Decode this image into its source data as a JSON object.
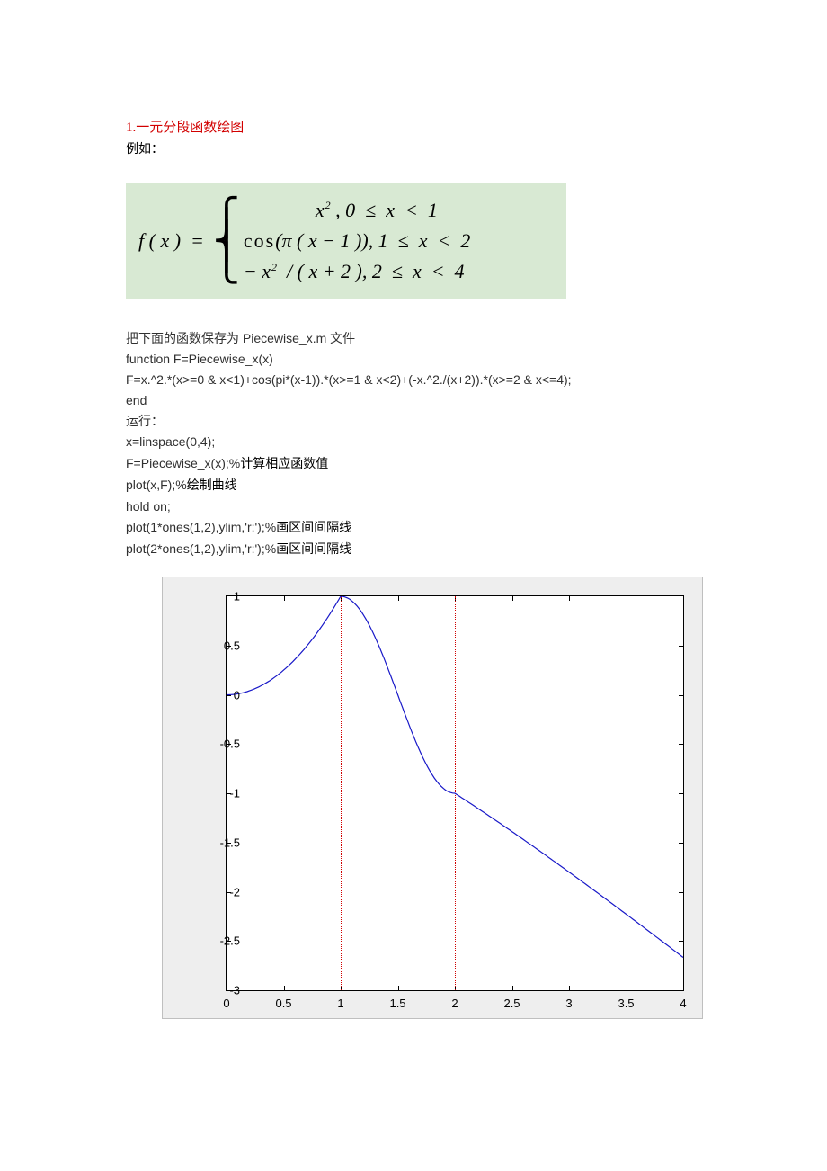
{
  "heading": "1.一元分段函数绘图",
  "example_label": "例如：",
  "equation": {
    "lhs": "f ( x )  =",
    "lines": [
      "x², 0 ≤ x < 1",
      "cos(π(x − 1)), 1 ≤ x < 2",
      "−x² / (x + 2), 2 ≤ x < 4"
    ]
  },
  "text_lines": {
    "l1": "把下面的函数保存为 Piecewise_x.m 文件",
    "l2": "function F=Piecewise_x(x)",
    "l3": "F=x.^2.*(x>=0 & x<1)+cos(pi*(x-1)).*(x>=1 & x<2)+(-x.^2./(x+2)).*(x>=2 & x<=4);",
    "l4": "end",
    "l5": "运行：",
    "l6": "x=linspace(0,4);",
    "l7a": "F=Piecewise_x(x);%",
    "l7b": "计算相应函数值",
    "l8a": "plot(x,F);%",
    "l8b": "绘制曲线",
    "l9": "hold on;",
    "l10a": "plot(1*ones(1,2),ylim,'r:');%",
    "l10b": "画区间间隔线",
    "l11a": "plot(2*ones(1,2),ylim,'r:');%",
    "l11b": "画区间间隔线"
  },
  "chart_data": {
    "type": "line",
    "xlabel": "",
    "ylabel": "",
    "xlim": [
      0,
      4
    ],
    "ylim": [
      -3,
      1
    ],
    "xticks": [
      0,
      0.5,
      1,
      1.5,
      2,
      2.5,
      3,
      3.5,
      4
    ],
    "yticks": [
      -3,
      -2.5,
      -2,
      -1.5,
      -1,
      -0.5,
      0,
      0.5,
      1
    ],
    "series": [
      {
        "name": "f(x)",
        "color": "#1818c8",
        "pieces": [
          {
            "formula": "x^2",
            "domain": [
              0,
              1
            ]
          },
          {
            "formula": "cos(pi*(x-1))",
            "domain": [
              1,
              2
            ]
          },
          {
            "formula": "-x^2/(x+2)",
            "domain": [
              2,
              4
            ]
          }
        ],
        "sample_points": {
          "x": [
            0,
            0.25,
            0.5,
            0.75,
            1,
            1.25,
            1.5,
            1.75,
            2,
            2.5,
            3,
            3.5,
            4
          ],
          "y": [
            0,
            0.0625,
            0.25,
            0.5625,
            1,
            0.7071,
            0,
            -0.7071,
            -1,
            -1.3889,
            -1.8,
            -2.2273,
            -2.6667
          ]
        }
      }
    ],
    "vlines": [
      {
        "x": 1,
        "style": "dotted",
        "color": "#d00000"
      },
      {
        "x": 2,
        "style": "dotted",
        "color": "#d00000"
      }
    ]
  }
}
